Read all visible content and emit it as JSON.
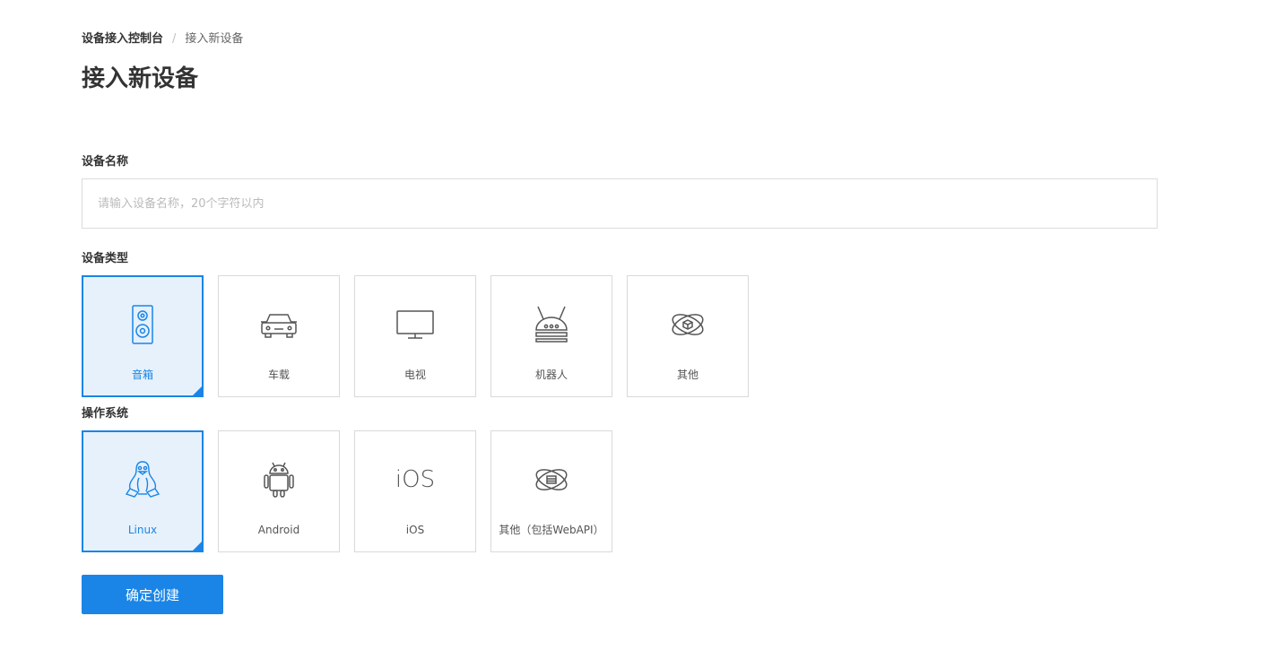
{
  "breadcrumb": {
    "root": "设备接入控制台",
    "separator": "/",
    "current": "接入新设备"
  },
  "title": "接入新设备",
  "device_name": {
    "label": "设备名称",
    "placeholder": "请输入设备名称，20个字符以内",
    "value": ""
  },
  "device_type": {
    "label": "设备类型",
    "selected": "音箱",
    "options": [
      {
        "label": "音箱",
        "icon": "speaker-icon"
      },
      {
        "label": "车载",
        "icon": "car-icon"
      },
      {
        "label": "电视",
        "icon": "tv-icon"
      },
      {
        "label": "机器人",
        "icon": "robot-icon"
      },
      {
        "label": "其他",
        "icon": "atom-icon"
      }
    ]
  },
  "os": {
    "label": "操作系统",
    "selected": "Linux",
    "options": [
      {
        "label": "Linux",
        "icon": "linux-penguin-icon"
      },
      {
        "label": "Android",
        "icon": "android-icon"
      },
      {
        "label": "iOS",
        "icon": "ios-icon",
        "icon_text": "iOS"
      },
      {
        "label": "其他（包括WebAPI）",
        "icon": "atom-web-icon"
      }
    ]
  },
  "submit_label": "确定创建",
  "colors": {
    "accent": "#1a85e6",
    "selected_bg": "#e6f1fc",
    "border": "#d9d9d9",
    "icon_gray": "#555555"
  }
}
